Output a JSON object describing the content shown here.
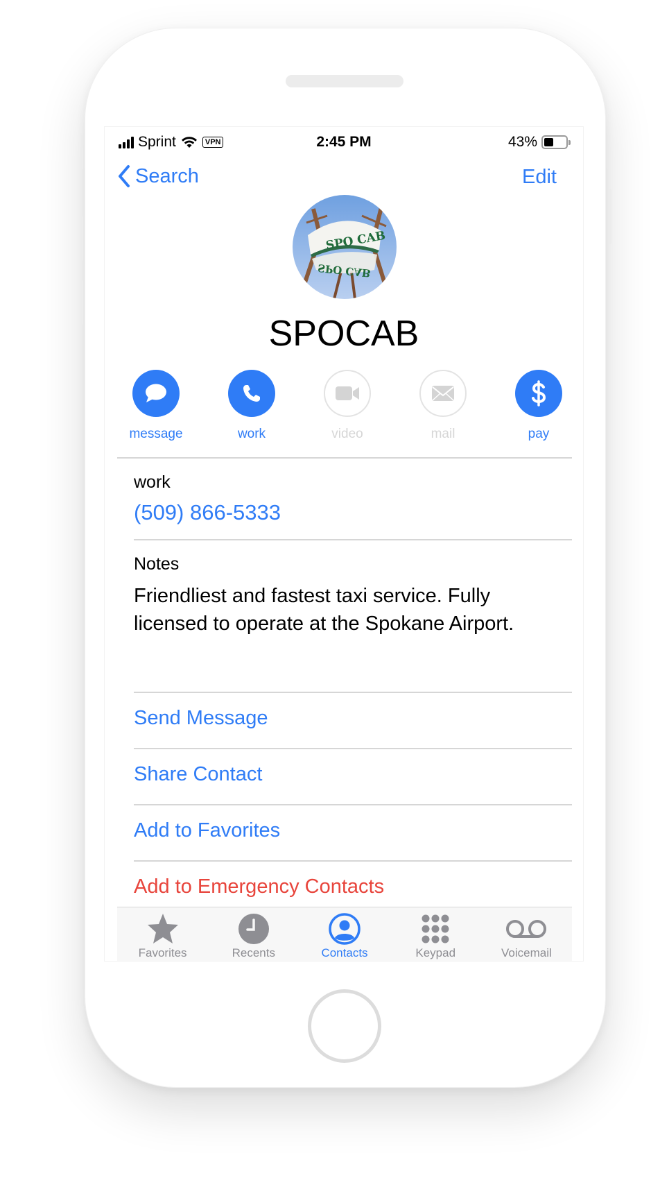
{
  "status_bar": {
    "carrier": "Sprint",
    "vpn": "VPN",
    "time": "2:45 PM",
    "battery": "43%",
    "battery_level": 0.43
  },
  "nav": {
    "back_label": "Search",
    "edit_label": "Edit"
  },
  "contact": {
    "name": "SPOCAB",
    "avatar_text_top": "SPO CAB",
    "avatar_text_bottom": "SPO CAB"
  },
  "actions": [
    {
      "label": "message",
      "icon": "message-bubble-icon",
      "enabled": true
    },
    {
      "label": "work",
      "icon": "phone-icon",
      "enabled": true
    },
    {
      "label": "video",
      "icon": "video-camera-icon",
      "enabled": false
    },
    {
      "label": "mail",
      "icon": "envelope-icon",
      "enabled": false
    },
    {
      "label": "pay",
      "icon": "dollar-icon",
      "enabled": true
    }
  ],
  "phone": {
    "label": "work",
    "number": "(509) 866-5333"
  },
  "notes": {
    "label": "Notes",
    "text": "Friendliest and fastest taxi service. Fully licensed to operate at the Spokane Airport."
  },
  "links": {
    "send_message": "Send Message",
    "share_contact": "Share Contact",
    "add_favorites": "Add to Favorites",
    "add_emergency": "Add to Emergency Contacts"
  },
  "tabbar": [
    {
      "label": "Favorites",
      "icon": "star-icon",
      "active": false
    },
    {
      "label": "Recents",
      "icon": "clock-icon",
      "active": false
    },
    {
      "label": "Contacts",
      "icon": "person-circle-icon",
      "active": true
    },
    {
      "label": "Keypad",
      "icon": "keypad-icon",
      "active": false
    },
    {
      "label": "Voicemail",
      "icon": "voicemail-icon",
      "active": false
    }
  ],
  "colors": {
    "accent": "#2f7cf6",
    "danger": "#e8453c",
    "inactive": "#8e8e93"
  }
}
